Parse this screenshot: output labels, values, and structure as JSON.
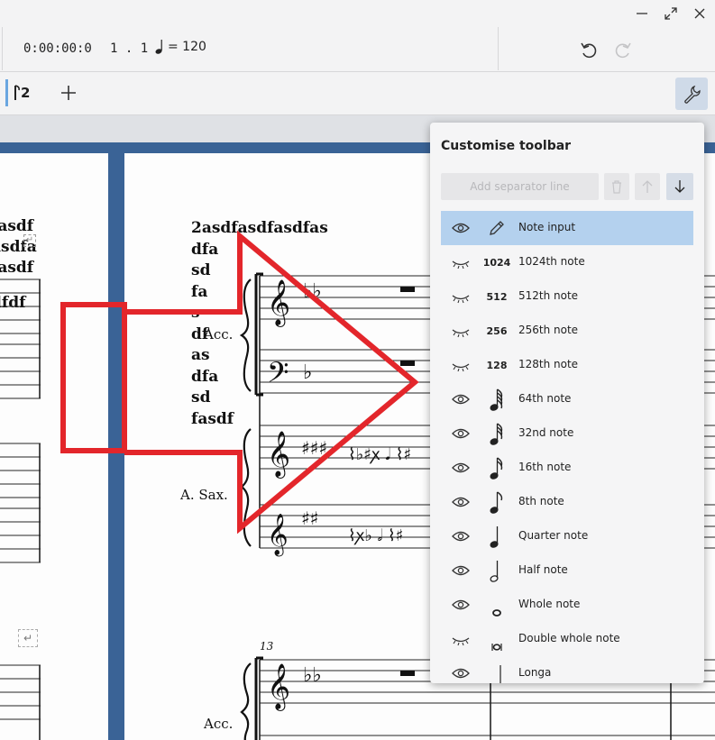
{
  "window": {
    "minimize_icon": "minimize-icon",
    "maximize_icon": "maximize-icon",
    "close_icon": "close-icon"
  },
  "playback": {
    "time": "0:00:00:0",
    "position": "1 . 1",
    "tempo": "= 120"
  },
  "note_toolbar": {
    "voice_label": "2"
  },
  "score": {
    "title_left_lines": [
      "fasdf",
      "asdfa",
      "fasdf",
      "dfdf"
    ],
    "title_main_lines": [
      "2asdfasdfasdfas",
      "dfa",
      "sd",
      "fa",
      "s",
      "df",
      "as",
      "dfa",
      "sd",
      "fasdf"
    ],
    "instrument_accordion": "Acc.",
    "instrument_sax": "A. Sax.",
    "measure_number": "13",
    "accent_color": "#3a6396",
    "arrow_color": "#e3262b"
  },
  "popup": {
    "title": "Customise toolbar",
    "add_separator_label": "Add separator line",
    "selected_color": "#b4d1ee",
    "items": [
      {
        "label": "Note input",
        "icon": "pencil",
        "visible": true,
        "selected": true
      },
      {
        "label": "1024th note",
        "icon": "1024",
        "visible": false
      },
      {
        "label": "512th note",
        "icon": "512",
        "visible": false
      },
      {
        "label": "256th note",
        "icon": "256",
        "visible": false
      },
      {
        "label": "128th note",
        "icon": "128",
        "visible": false
      },
      {
        "label": "64th note",
        "icon": "flag-4",
        "visible": true
      },
      {
        "label": "32nd note",
        "icon": "flag-3",
        "visible": true
      },
      {
        "label": "16th note",
        "icon": "flag-2",
        "visible": true
      },
      {
        "label": "8th note",
        "icon": "flag-1",
        "visible": true
      },
      {
        "label": "Quarter note",
        "icon": "quarter",
        "visible": true
      },
      {
        "label": "Half note",
        "icon": "half",
        "visible": true
      },
      {
        "label": "Whole note",
        "icon": "whole",
        "visible": true
      },
      {
        "label": "Double whole note",
        "icon": "breve",
        "visible": false
      },
      {
        "label": "Longa",
        "icon": "longa",
        "visible": true
      }
    ]
  }
}
